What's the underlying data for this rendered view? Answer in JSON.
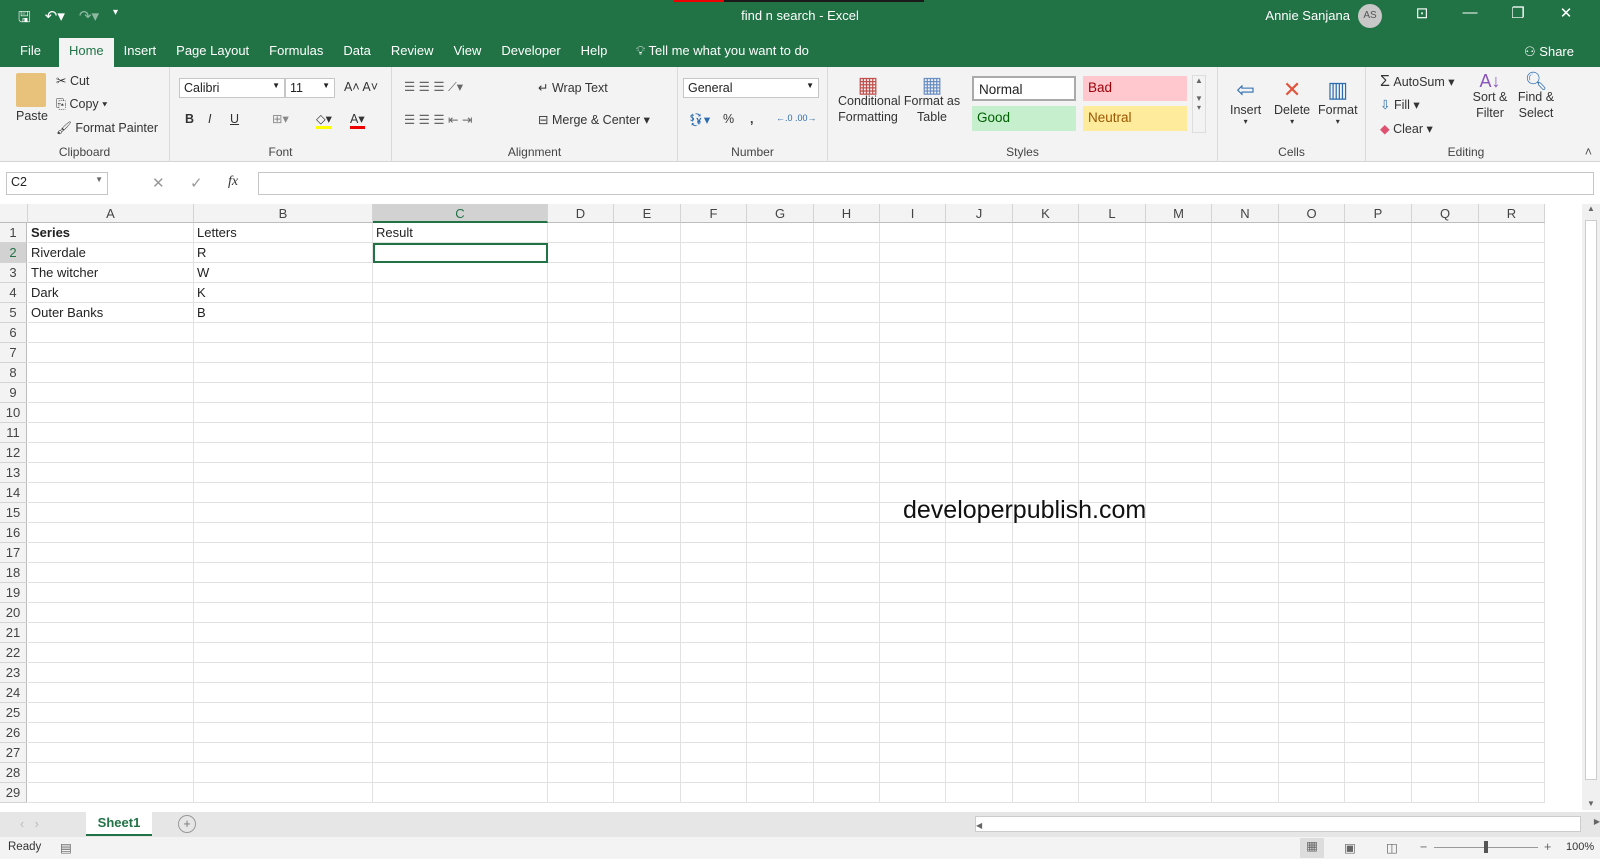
{
  "window": {
    "title": "find n search  -  Excel",
    "user": "Annie Sanjana",
    "initials": "AS",
    "share": "Share",
    "tell_me": "Tell me what you want to do"
  },
  "tabs": [
    "File",
    "Home",
    "Insert",
    "Page Layout",
    "Formulas",
    "Data",
    "Review",
    "View",
    "Developer",
    "Help"
  ],
  "active_tab": "Home",
  "ribbon": {
    "clipboard": {
      "label": "Clipboard",
      "paste": "Paste",
      "cut": "Cut",
      "copy": "Copy",
      "format_painter": "Format Painter"
    },
    "font": {
      "label": "Font",
      "name": "Calibri",
      "size": "11",
      "bold": "B",
      "italic": "I",
      "underline": "U"
    },
    "alignment": {
      "label": "Alignment",
      "wrap": "Wrap Text",
      "merge": "Merge & Center"
    },
    "number": {
      "label": "Number",
      "format": "General",
      "percent": "%",
      "comma": ","
    },
    "styles": {
      "label": "Styles",
      "conditional": "Conditional Formatting",
      "format_table": "Format as Table",
      "normal": "Normal",
      "bad": "Bad",
      "good": "Good",
      "neutral": "Neutral"
    },
    "cells": {
      "label": "Cells",
      "insert": "Insert",
      "delete": "Delete",
      "format": "Format"
    },
    "editing": {
      "label": "Editing",
      "autosum": "AutoSum",
      "fill": "Fill",
      "clear": "Clear",
      "sort": "Sort & Filter",
      "find": "Find & Select"
    }
  },
  "formula_bar": {
    "name_box": "C2",
    "fx": "fx",
    "value": ""
  },
  "columns": [
    "A",
    "B",
    "C",
    "D",
    "E",
    "F",
    "G",
    "H",
    "I",
    "J",
    "K",
    "L",
    "M",
    "N",
    "O",
    "P",
    "Q",
    "R"
  ],
  "selected_cell": "C2",
  "cells": [
    [
      "Series",
      "Letters",
      "Result"
    ],
    [
      "Riverdale",
      "R",
      ""
    ],
    [
      "The witcher",
      "W",
      ""
    ],
    [
      "Dark",
      "K",
      ""
    ],
    [
      "Outer Banks",
      "B",
      ""
    ]
  ],
  "row_count": 29,
  "watermark": "developerpublish.com",
  "sheets": [
    "Sheet1"
  ],
  "status": {
    "ready": "Ready",
    "zoom": "100%"
  },
  "colors": {
    "accent": "#217346",
    "bad_bg": "#ffc7ce",
    "good_bg": "#c6efce",
    "neutral_bg": "#ffeb9c"
  }
}
